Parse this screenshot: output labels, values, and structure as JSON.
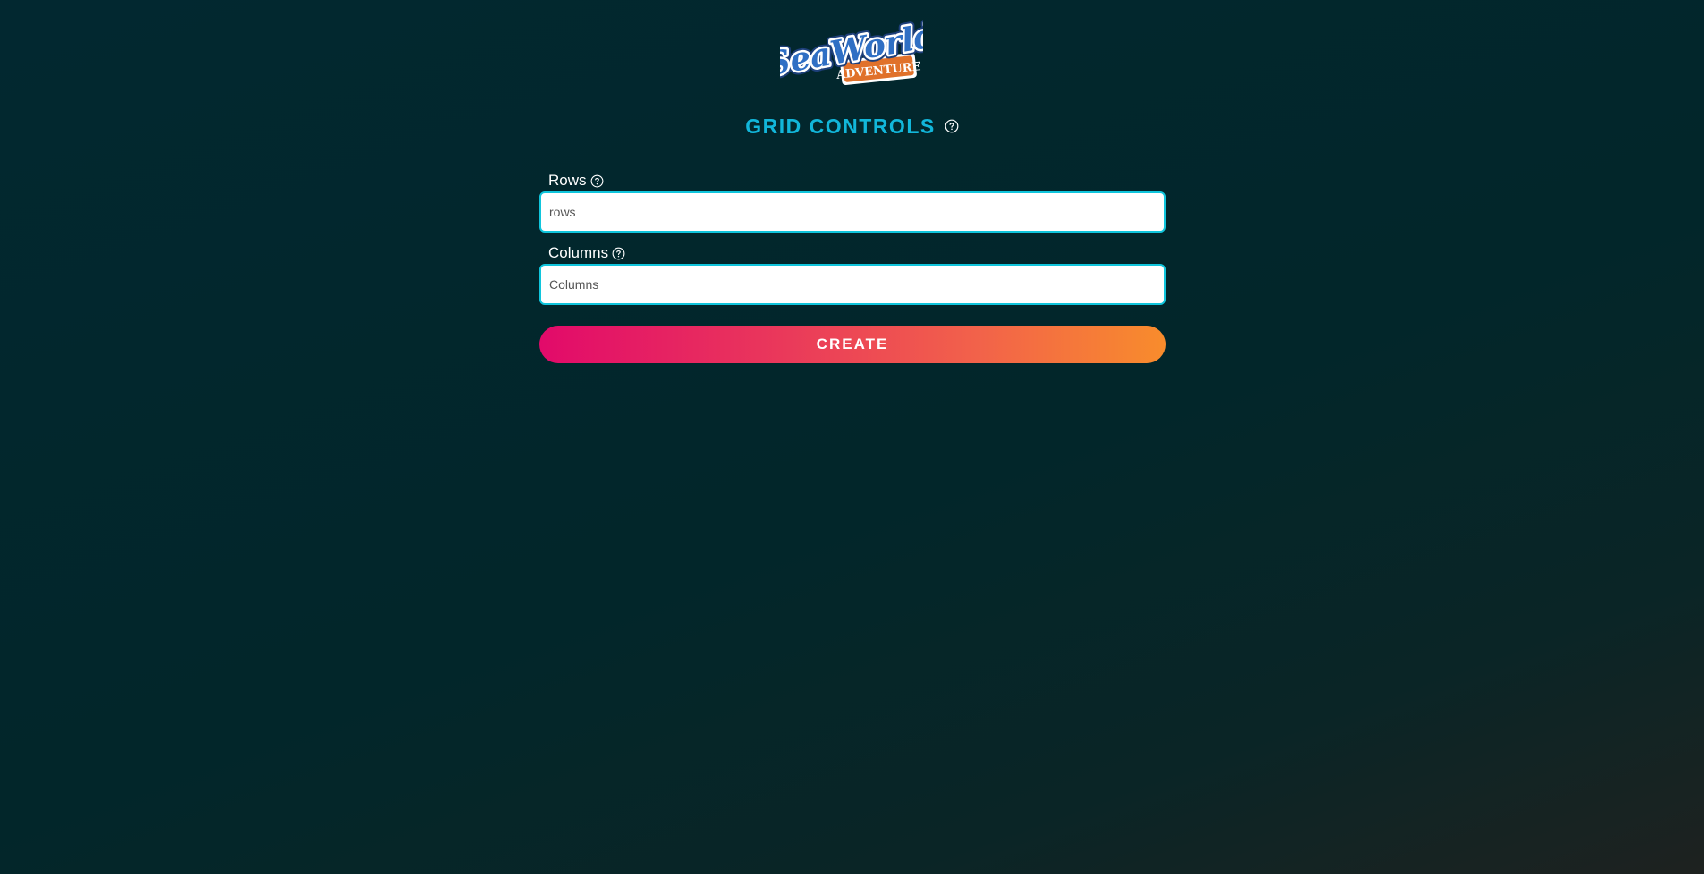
{
  "logo": {
    "text_main": "SeaWorld",
    "text_sub": "ADVENTURE",
    "colors": {
      "blue": "#2f6fc4",
      "orange": "#e0712a",
      "white": "#ffffff"
    }
  },
  "header": {
    "title": "GRID CONTROLS",
    "title_color": "#12b6da",
    "help_icon": "question-circle-icon"
  },
  "form": {
    "rows": {
      "label": "Rows",
      "help_icon": "question-circle-icon",
      "placeholder": "rows",
      "value": ""
    },
    "columns": {
      "label": "Columns",
      "help_icon": "question-circle-icon",
      "placeholder": "Columns",
      "value": ""
    },
    "create_button": {
      "label": "CREATE",
      "gradient": [
        "#e20a6a",
        "#f88c2c"
      ]
    }
  },
  "theme": {
    "background": "#022830",
    "input_border": "#10c5dc"
  }
}
